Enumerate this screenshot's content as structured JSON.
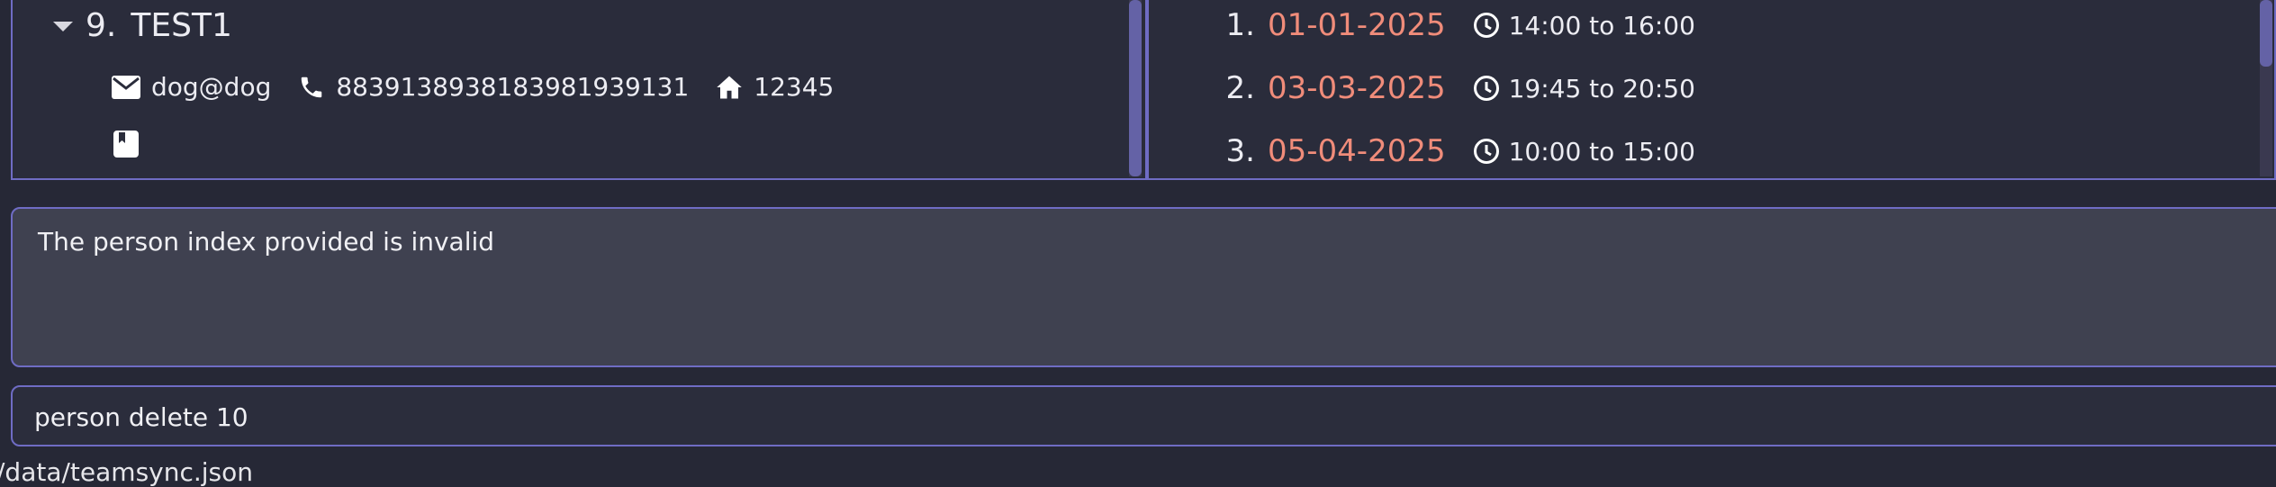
{
  "person": {
    "index": "9.",
    "name": "TEST1",
    "email": "dog@dog",
    "phone": "88391389381839819391​31",
    "address": "12345"
  },
  "events": [
    {
      "num": "1.",
      "date": "01-01-2025",
      "time": "14:00 to 16:00"
    },
    {
      "num": "2.",
      "date": "03-03-2025",
      "time": "19:45 to 20:50"
    },
    {
      "num": "3.",
      "date": "05-04-2025",
      "time": "10:00 to 15:00"
    }
  ],
  "result": {
    "message": "The person index provided is invalid"
  },
  "command": {
    "value": "person delete 10"
  },
  "status": {
    "path": "/data/teamsync.json"
  },
  "icons": {
    "email": "mail-icon",
    "phone": "phone-icon",
    "address": "home-icon",
    "note": "bookmark-icon",
    "time": "clock-icon",
    "expand": "caret-down-icon"
  },
  "colors": {
    "accent": "#6f6cc4",
    "date": "#f08c7a",
    "background": "#262836"
  }
}
